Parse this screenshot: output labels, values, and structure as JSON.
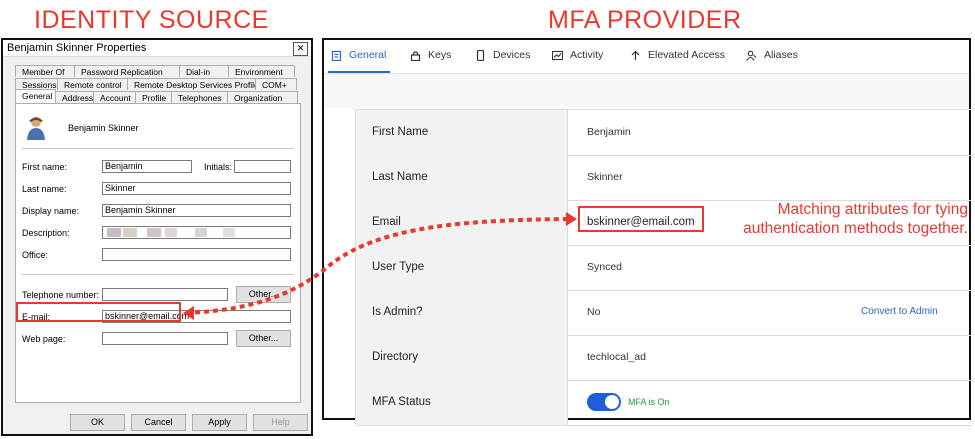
{
  "headings": {
    "left": "IDENTITY SOURCE",
    "right": "MFA PROVIDER"
  },
  "ad_dialog": {
    "title": "Benjamin Skinner Properties",
    "close": "✕",
    "tabs_row1": [
      "Member Of",
      "Password Replication",
      "Dial-in",
      "Environment"
    ],
    "tabs_row2": [
      "Sessions",
      "Remote control",
      "Remote Desktop Services Profile",
      "COM+"
    ],
    "tabs_row3": [
      "General",
      "Address",
      "Account",
      "Profile",
      "Telephones",
      "Organization"
    ],
    "user_name": "Benjamin Skinner",
    "fields": {
      "first_name_label": "First name:",
      "first_name": "Benjamin",
      "initials_label": "Initials:",
      "last_name_label": "Last name:",
      "last_name": "Skinner",
      "display_name_label": "Display name:",
      "display_name": "Benjamin Skinner",
      "description_label": "Description:",
      "office_label": "Office:",
      "telephone_label": "Telephone number:",
      "email_label": "E-mail:",
      "email": "bskinner@email.com",
      "webpage_label": "Web page:"
    },
    "buttons": {
      "other1": "Other...",
      "other2": "Other...",
      "ok": "OK",
      "cancel": "Cancel",
      "apply": "Apply",
      "help": "Help"
    }
  },
  "mfa": {
    "tabs": [
      {
        "label": "General",
        "icon": "clipboard-icon"
      },
      {
        "label": "Keys",
        "icon": "lock-icon"
      },
      {
        "label": "Devices",
        "icon": "phone-icon"
      },
      {
        "label": "Activity",
        "icon": "chart-icon"
      },
      {
        "label": "Elevated Access",
        "icon": "arrow-up-icon"
      },
      {
        "label": "Aliases",
        "icon": "user-icon"
      }
    ],
    "rows": [
      {
        "key": "First Name",
        "value": "Benjamin"
      },
      {
        "key": "Last Name",
        "value": "Skinner"
      },
      {
        "key": "Email",
        "value": "bskinner@email.com"
      },
      {
        "key": "User Type",
        "value": "Synced"
      },
      {
        "key": "Is Admin?",
        "value": "No",
        "action": "Convert to Admin"
      },
      {
        "key": "Directory",
        "value": "techlocal_ad"
      },
      {
        "key": "MFA Status",
        "toggle_text": "MFA is On",
        "toggle_on": true
      }
    ]
  },
  "annotation": {
    "line1": "Matching attributes for tying",
    "line2": "authentication methods together."
  },
  "colors": {
    "annotation_red": "#e8392f",
    "accent_blue": "#2a63c9",
    "toggle_blue": "#1f5fd6",
    "status_green": "#1e9e3a"
  }
}
